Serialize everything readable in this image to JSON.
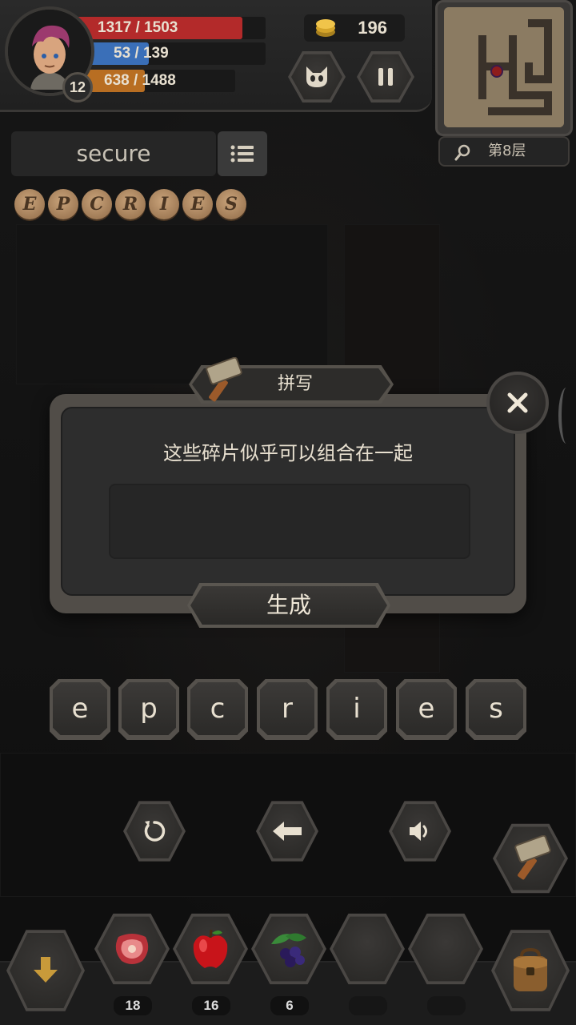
{
  "hud": {
    "level": "12",
    "hp": {
      "current": "1317",
      "max": "1503",
      "text": "1317 / 1503",
      "fraction": 0.876,
      "color": "#b32a2a"
    },
    "mp": {
      "current": "53",
      "max": "139",
      "text": "53 / 139",
      "fraction": 0.381,
      "color": "#3a6fb8"
    },
    "xp": {
      "current": "638",
      "max": "1488",
      "text": "638 / 1488",
      "fraction": 0.429,
      "color": "#b86e22"
    },
    "gold": "196",
    "floor": "第8层"
  },
  "word_panel": {
    "word": "secure",
    "fragments": [
      "E",
      "P",
      "C",
      "R",
      "I",
      "E",
      "S"
    ]
  },
  "dialog": {
    "title": "拼写",
    "message": "这些碎片似乎可以组合在一起",
    "input_value": "",
    "generate_label": "生成"
  },
  "letters": [
    "e",
    "p",
    "c",
    "r",
    "i",
    "e",
    "s"
  ],
  "inventory": {
    "slots": [
      {
        "icon": "meat-icon",
        "count": "18"
      },
      {
        "icon": "apple-icon",
        "count": "16"
      },
      {
        "icon": "berries-icon",
        "count": "6"
      },
      {
        "icon": "",
        "count": ""
      },
      {
        "icon": "",
        "count": ""
      }
    ]
  }
}
